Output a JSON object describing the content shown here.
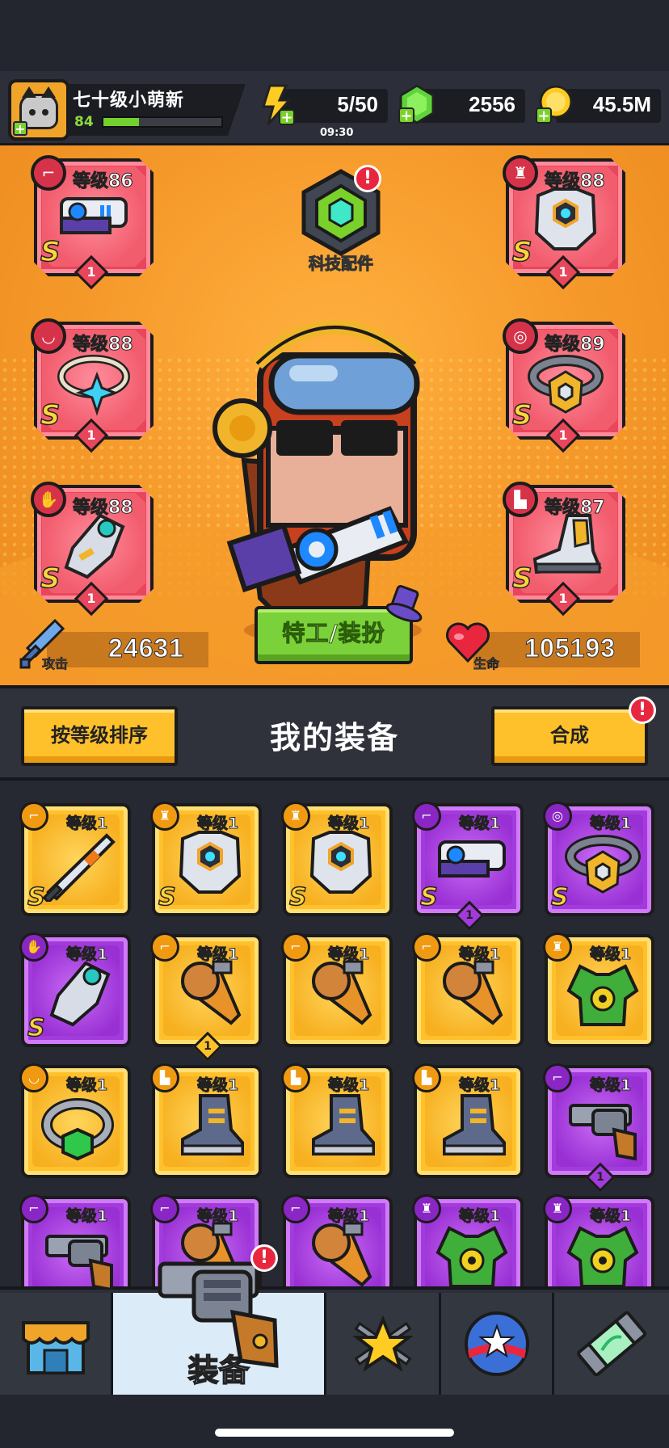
{
  "hud": {
    "player_name": "七十级小萌新",
    "player_level": "84",
    "xp_fraction": 0.3,
    "energy": "5/50",
    "energy_timer": "09:30",
    "gems": "2556",
    "gold": "45.5M"
  },
  "tech_part": {
    "label": "科技配件",
    "alert": "!"
  },
  "equipped": {
    "weapon": {
      "level": "等级86",
      "rank": "S",
      "tier": "1",
      "type_icon": "gun-icon"
    },
    "armor": {
      "level": "等级88",
      "rank": "S",
      "tier": "1",
      "type_icon": "shirt-icon"
    },
    "necklace": {
      "level": "等级88",
      "rank": "S",
      "tier": "1",
      "type_icon": "necklace-icon"
    },
    "belt": {
      "level": "等级89",
      "rank": "S",
      "tier": "1",
      "type_icon": "belt-icon"
    },
    "gloves": {
      "level": "等级88",
      "rank": "S",
      "tier": "1",
      "type_icon": "glove-icon"
    },
    "boots": {
      "level": "等级87",
      "rank": "S",
      "tier": "1",
      "type_icon": "boot-icon"
    }
  },
  "stats": {
    "attack_label": "攻击",
    "attack": "24631",
    "hp_label": "生命",
    "hp": "105193"
  },
  "agent_button": "特工/装扮",
  "equipment": {
    "sort_button": "按等级排序",
    "title": "我的装备",
    "synth_button": "合成",
    "synth_alert": "!",
    "items": [
      {
        "level": "等级1",
        "rarity": "gold",
        "rank": "S",
        "tier": "",
        "kind": "sword"
      },
      {
        "level": "等级1",
        "rarity": "gold",
        "rank": "S",
        "tier": "",
        "kind": "armor"
      },
      {
        "level": "等级1",
        "rarity": "gold",
        "rank": "S",
        "tier": "",
        "kind": "armor"
      },
      {
        "level": "等级1",
        "rarity": "purple",
        "rank": "S",
        "tier": "1",
        "kind": "blaster"
      },
      {
        "level": "等级1",
        "rarity": "purple",
        "rank": "S",
        "tier": "",
        "kind": "belt"
      },
      {
        "level": "等级1",
        "rarity": "purple",
        "rank": "S",
        "tier": "",
        "kind": "glove"
      },
      {
        "level": "等级1",
        "rarity": "gold",
        "rank": "",
        "tier": "1",
        "kind": "drill"
      },
      {
        "level": "等级1",
        "rarity": "gold",
        "rank": "",
        "tier": "",
        "kind": "drill"
      },
      {
        "level": "等级1",
        "rarity": "gold",
        "rank": "",
        "tier": "",
        "kind": "drill"
      },
      {
        "level": "等级1",
        "rarity": "gold",
        "rank": "",
        "tier": "",
        "kind": "vest"
      },
      {
        "level": "等级1",
        "rarity": "gold",
        "rank": "",
        "tier": "",
        "kind": "ring"
      },
      {
        "level": "等级1",
        "rarity": "gold",
        "rank": "",
        "tier": "",
        "kind": "boot"
      },
      {
        "level": "等级1",
        "rarity": "gold",
        "rank": "",
        "tier": "",
        "kind": "boot"
      },
      {
        "level": "等级1",
        "rarity": "gold",
        "rank": "",
        "tier": "",
        "kind": "boot"
      },
      {
        "level": "等级1",
        "rarity": "purple",
        "rank": "",
        "tier": "1",
        "kind": "revolver"
      },
      {
        "level": "等级1",
        "rarity": "purple",
        "rank": "",
        "tier": "",
        "kind": "revolver"
      },
      {
        "level": "等级1",
        "rarity": "purple",
        "rank": "",
        "tier": "",
        "kind": "drill"
      },
      {
        "level": "等级1",
        "rarity": "purple",
        "rank": "",
        "tier": "",
        "kind": "drill"
      },
      {
        "level": "等级1",
        "rarity": "purple",
        "rank": "",
        "tier": "",
        "kind": "vest"
      },
      {
        "level": "等级1",
        "rarity": "purple",
        "rank": "",
        "tier": "",
        "kind": "vest"
      }
    ]
  },
  "nav": {
    "tabs": [
      {
        "name": "shop",
        "icon": "shop-icon",
        "label": ""
      },
      {
        "name": "equipment",
        "icon": "revolver-icon",
        "label": "装备",
        "active": true,
        "alert": "!"
      },
      {
        "name": "battle",
        "icon": "star-swords-icon",
        "label": ""
      },
      {
        "name": "gacha",
        "icon": "star-ball-icon",
        "label": ""
      },
      {
        "name": "dna",
        "icon": "dna-tube-icon",
        "label": ""
      }
    ]
  }
}
